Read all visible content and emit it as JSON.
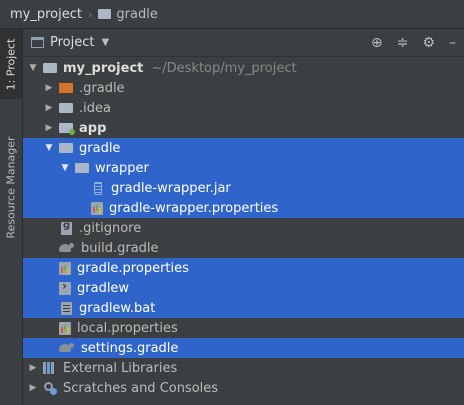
{
  "breadcrumb": {
    "project": "my_project",
    "folder": "gradle"
  },
  "sidebar": {
    "project_tab": "1: Project",
    "resource_tab": "Resource Manager"
  },
  "panel": {
    "title": "Project"
  },
  "tree": {
    "root": {
      "name": "my_project",
      "path": "~/Desktop/my_project"
    },
    "items": [
      {
        "label": ".gradle"
      },
      {
        "label": ".idea"
      },
      {
        "label": "app"
      },
      {
        "label": "gradle"
      },
      {
        "label": "wrapper"
      },
      {
        "label": "gradle-wrapper.jar"
      },
      {
        "label": "gradle-wrapper.properties"
      },
      {
        "label": ".gitignore"
      },
      {
        "label": "build.gradle"
      },
      {
        "label": "gradle.properties"
      },
      {
        "label": "gradlew"
      },
      {
        "label": "gradlew.bat"
      },
      {
        "label": "local.properties"
      },
      {
        "label": "settings.gradle"
      },
      {
        "label": "External Libraries"
      },
      {
        "label": "Scratches and Consoles"
      }
    ]
  },
  "colors": {
    "background": "#3c3f41",
    "selection": "#2f65ca",
    "text": "#bbbbbb"
  }
}
